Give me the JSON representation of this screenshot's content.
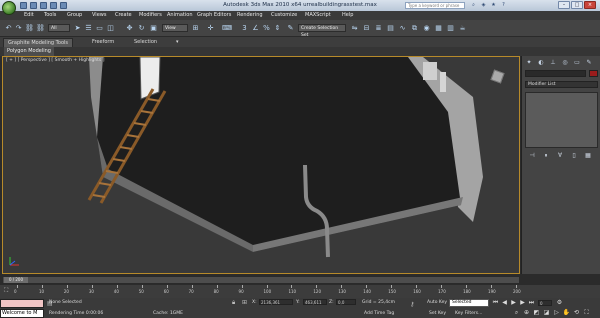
{
  "window": {
    "title": "Autodesk 3ds Max 2010 x64      urrealbuildingrasstest.max",
    "search_placeholder": "Type a keyword or phrase"
  },
  "menu": [
    "Edit",
    "Tools",
    "Group",
    "Views",
    "Create",
    "Modifiers",
    "Animation",
    "Graph Editors",
    "Rendering",
    "Customize",
    "MAXScript",
    "Help"
  ],
  "toolbar": {
    "selection_filter": "All",
    "coord_system": "View",
    "named_selection": "Create Selection Set"
  },
  "ribbon": {
    "tabs": [
      "Graphite Modeling Tools",
      "Freeform",
      "Selection"
    ],
    "panel_label": "Polygon Modeling"
  },
  "viewport": {
    "label": "[ + ] [ Perspective ] [ Smooth + Highlights ]"
  },
  "command_panel": {
    "modifier_list": "Modifier List"
  },
  "timeline": {
    "slider_label": "0 / 200",
    "ticks": [
      "0",
      "10",
      "20",
      "30",
      "40",
      "50",
      "60",
      "70",
      "80",
      "90",
      "100",
      "110",
      "120",
      "130",
      "140",
      "150",
      "160",
      "170",
      "180",
      "190",
      "200"
    ]
  },
  "status": {
    "maxscript_text": "Welcome to M",
    "selection_info": "None Selected",
    "x_value": "2136,361",
    "y_value": "463,611",
    "z_value": "0,0",
    "grid": "Grid = 25,4cm",
    "auto_key": "Auto Key",
    "set_key": "Set Key",
    "selected_label": "Selected",
    "key_filters": "Key Filters...",
    "frame_value": "0",
    "render_time": "Rendering Time 0:00:06",
    "cache": "Cache: 1GME",
    "add_time_tag": "Add Time Tag"
  },
  "colors": {
    "accent_viewport_border": "#b78a2a",
    "material_swatch": "#9a1c1c",
    "maxscript_input": "#f0c4c4"
  }
}
